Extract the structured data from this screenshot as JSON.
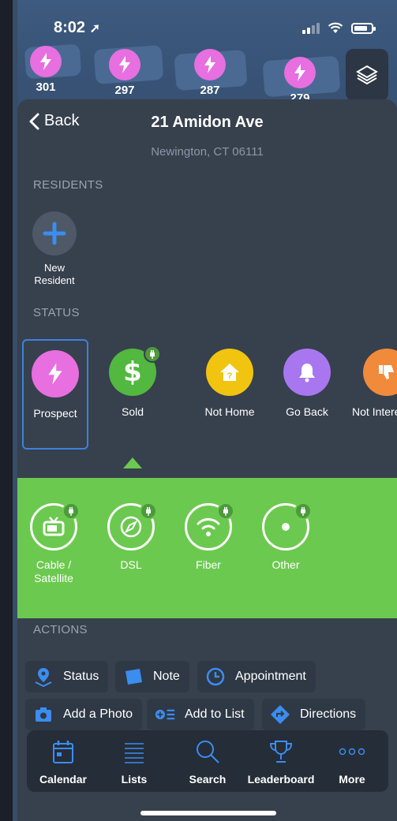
{
  "status_bar": {
    "time": "8:02"
  },
  "map": {
    "pins": [
      {
        "label": "301"
      },
      {
        "label": "297"
      },
      {
        "label": "287"
      },
      {
        "label": "279"
      }
    ]
  },
  "header": {
    "back_label": "Back",
    "title": "21 Amidon Ave",
    "subtitle": "Newington, CT 06111"
  },
  "residents": {
    "section_label": "RESIDENTS",
    "new_resident_label": "New Resident"
  },
  "status": {
    "section_label": "STATUS",
    "items": [
      {
        "label": "Prospect",
        "color": "#e76fe0",
        "icon": "bolt-icon",
        "selected": true
      },
      {
        "label": "Sold",
        "color": "#52b83f",
        "icon": "dollar-icon"
      },
      {
        "label": "Not Home",
        "color": "#f1c40f",
        "icon": "house-question-icon"
      },
      {
        "label": "Go Back",
        "color": "#a877f0",
        "icon": "bell-icon"
      },
      {
        "label": "Not Interested",
        "color": "#f28a3b",
        "icon": "thumbs-down-icon"
      }
    ]
  },
  "sub_status": {
    "panel_color": "#6cc94f",
    "items": [
      {
        "label": "Cable / Satellite",
        "icon": "tv-icon"
      },
      {
        "label": "DSL",
        "icon": "compass-icon"
      },
      {
        "label": "Fiber",
        "icon": "wifi-icon"
      },
      {
        "label": "Other",
        "icon": "dot-icon"
      }
    ]
  },
  "actions": {
    "section_label": "ACTIONS",
    "buttons": [
      {
        "label": "Status",
        "icon": "map-pin-icon"
      },
      {
        "label": "Note",
        "icon": "note-icon"
      },
      {
        "label": "Appointment",
        "icon": "clock-icon"
      },
      {
        "label": "Add a Photo",
        "icon": "camera-icon"
      },
      {
        "label": "Add to List",
        "icon": "add-list-icon"
      },
      {
        "label": "Directions",
        "icon": "directions-icon"
      }
    ]
  },
  "tabbar": {
    "tabs": [
      {
        "label": "Calendar",
        "icon": "calendar-icon"
      },
      {
        "label": "Lists",
        "icon": "list-icon"
      },
      {
        "label": "Search",
        "icon": "search-icon"
      },
      {
        "label": "Leaderboard",
        "icon": "trophy-icon"
      },
      {
        "label": "More",
        "icon": "more-icon"
      }
    ]
  }
}
